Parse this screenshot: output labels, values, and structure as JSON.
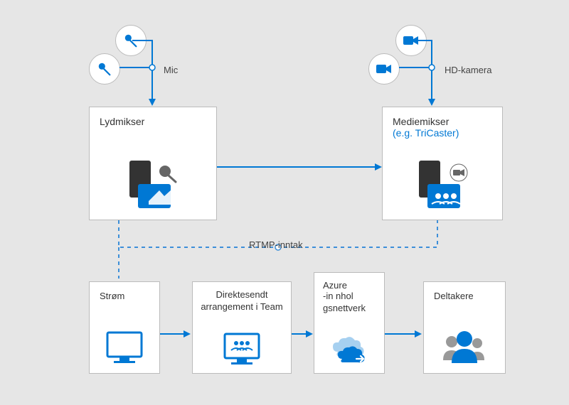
{
  "labels": {
    "mic": "Mic",
    "hdCamera": "HD-kamera",
    "rtmp": "RTMP-inntak"
  },
  "nodes": {
    "audioMixer": {
      "title": "Lydmikser"
    },
    "mediaMixer": {
      "title": "Mediemikser",
      "subtitle": "(e.g. TriCaster)"
    },
    "stream": {
      "title": "Strøm"
    },
    "liveEvent": {
      "title": "Direktesendt arrangement i Team"
    },
    "azure": {
      "title": "Azure",
      "subtitle": "-in nhol gsnettverk"
    },
    "attendees": {
      "title": "Deltakere"
    }
  },
  "colors": {
    "blue": "#0078D4",
    "lightGray": "#bbb",
    "dashedBlue": "#3D8FD9"
  }
}
